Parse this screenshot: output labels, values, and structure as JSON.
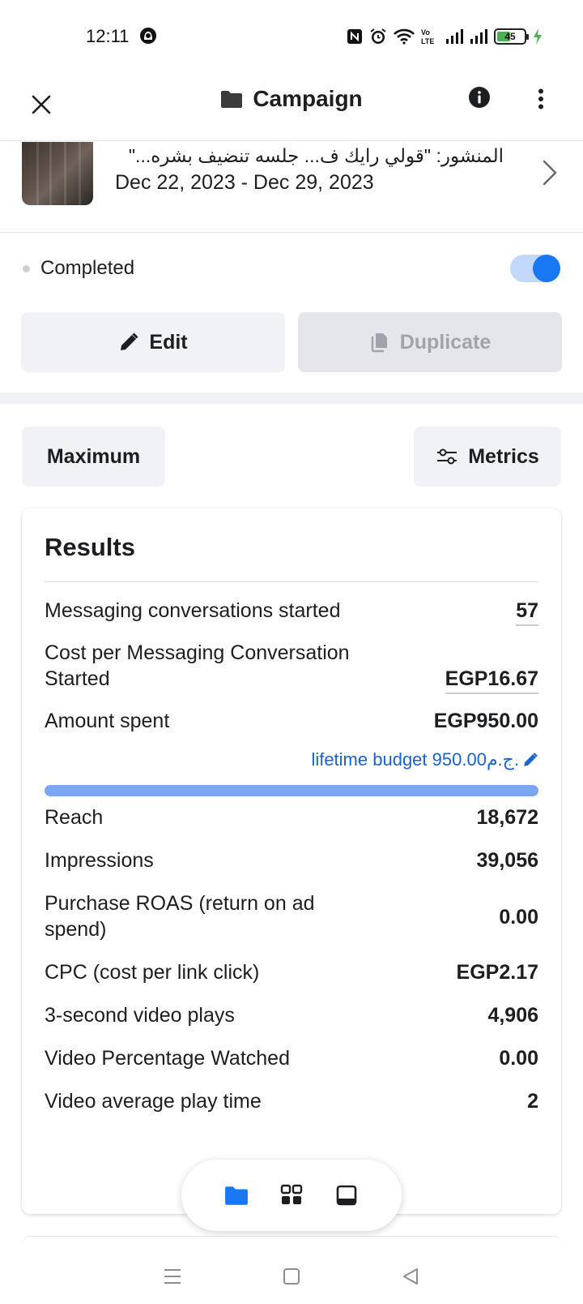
{
  "status_bar": {
    "time": "12:11",
    "battery": "45",
    "icons": [
      "nfc-icon",
      "alarm-icon",
      "wifi-icon",
      "volte-icon",
      "signal-icon",
      "signal-icon",
      "battery-icon",
      "charging-icon"
    ]
  },
  "header": {
    "title": "Campaign",
    "icons": [
      "close-icon",
      "folder-icon",
      "info-icon",
      "more-vertical-icon"
    ]
  },
  "post": {
    "title": "المنشور: \"قولي رايك ف... جلسه تنضيف بشره...\"",
    "dates": "Dec 22, 2023 - Dec 29, 2023"
  },
  "status": {
    "label": "Completed",
    "toggle_on": true
  },
  "actions": {
    "edit": "Edit",
    "duplicate": "Duplicate"
  },
  "filters": {
    "date_range": "Maximum",
    "metrics": "Metrics"
  },
  "results": {
    "title": "Results",
    "messaging_label": "Messaging conversations started",
    "messaging_value": "57",
    "cost_per_msg_label_1": "Cost per Messaging Conversation",
    "cost_per_msg_label_2": "Started",
    "cost_per_msg_value": "EGP16.67",
    "amount_spent_label": "Amount spent",
    "amount_spent_value": "EGP950.00",
    "budget_link": "lifetime budget 950.00ج.م.",
    "budget_spent_fraction": 1.0,
    "reach_label": "Reach",
    "reach_value": "18,672",
    "impressions_label": "Impressions",
    "impressions_value": "39,056",
    "roas_label_1": "Purchase ROAS (return on ad",
    "roas_label_2": "spend)",
    "roas_value": "0.00",
    "cpc_label": "CPC (cost per link click)",
    "cpc_value": "EGP2.17",
    "video_plays_label": "3-second video plays",
    "video_plays_value": "4,906",
    "video_pct_label": "Video Percentage Watched",
    "video_pct_value": "0.00",
    "video_avg_label": "Video average play time",
    "video_avg_value": "2"
  },
  "floating_nav": {
    "items": [
      "folder-icon",
      "grid-icon",
      "tablet-icon"
    ],
    "active": 0,
    "accent": "#1877f2"
  },
  "system_nav": [
    "menu-icon",
    "home-icon",
    "back-icon"
  ]
}
